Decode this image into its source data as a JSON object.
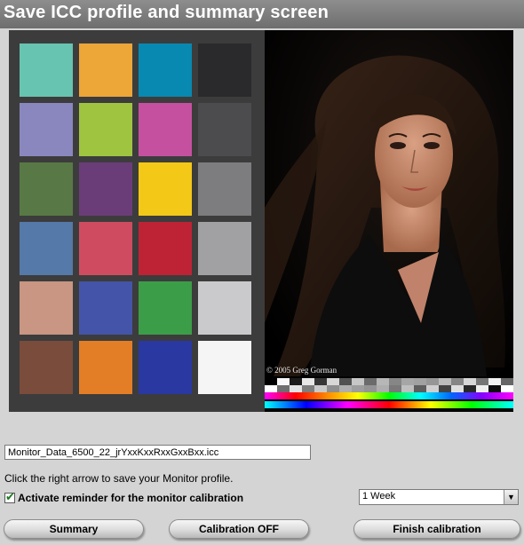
{
  "header": {
    "title": "Save ICC profile and summary screen"
  },
  "color_chart": {
    "patches": [
      [
        "#66c4b1",
        "#eda638",
        "#0789b2",
        "#2a2a2c"
      ],
      [
        "#8a87bf",
        "#9fc440",
        "#c650a0",
        "#4c4c4e"
      ],
      [
        "#587945",
        "#6a3d78",
        "#f4c816",
        "#7d7d7f"
      ],
      [
        "#5579a8",
        "#cf4c60",
        "#be2335",
        "#a1a1a3"
      ],
      [
        "#c89682",
        "#4454a8",
        "#3c9d48",
        "#cacacc"
      ],
      [
        "#7a4c3c",
        "#e37e26",
        "#2a38a2",
        "#f5f5f5"
      ]
    ]
  },
  "photo": {
    "credit": "© 2005 Greg Gorman"
  },
  "filename": {
    "value": "Monitor_Data_6500_22_jrYxxKxxRxxGxxBxx.icc"
  },
  "hint": {
    "text": "Click the right arrow to save your Monitor profile."
  },
  "reminder": {
    "label": "Activate reminder for the monitor calibration",
    "checked": true
  },
  "interval_select": {
    "value": "1 Week"
  },
  "buttons": {
    "summary": "Summary",
    "calibration_off": "Calibration OFF",
    "finish": "Finish calibration"
  }
}
